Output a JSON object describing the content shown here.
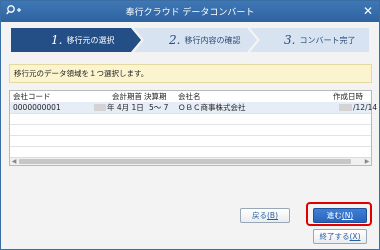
{
  "window": {
    "title": "奉行クラウド データコンバート",
    "close_glyph": "✕"
  },
  "steps": [
    {
      "num": "1.",
      "label": "移行元の選択",
      "active": true
    },
    {
      "num": "2.",
      "label": "移行内容の確認",
      "active": false
    },
    {
      "num": "3.",
      "label": "コンバート完了",
      "active": false
    }
  ],
  "notice": "移行元のデータ領域を１つ選択します。",
  "grid": {
    "columns": [
      "会社コード",
      "会計期首",
      "決算期",
      "会社名",
      "作成日時"
    ],
    "rows": [
      {
        "code": "0000000001",
        "start": "年 4月 1日",
        "period": "5～ 7",
        "name": "ＯＢＣ商事株式会社",
        "created": "/12/14"
      }
    ]
  },
  "buttons": {
    "back": {
      "label": "戻る",
      "key": "(B)"
    },
    "next": {
      "label": "進む",
      "key": "(N)"
    },
    "exit": {
      "label": "終了する",
      "key": "(X)"
    }
  },
  "colors": {
    "titlebar": "#2e63a0",
    "step_active": "#244f86",
    "step_inactive": "#d7e3f0",
    "highlight": "#e00000"
  }
}
